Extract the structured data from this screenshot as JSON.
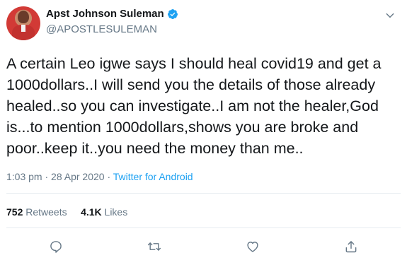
{
  "author": {
    "display_name": "Apst Johnson Suleman",
    "handle": "@APOSTLESULEMAN",
    "verified": true
  },
  "tweet": {
    "text": "A certain Leo igwe says I should heal covid19 and get a 1000dollars..I will send you the details of those already healed..so you can investigate..I am not the healer,God is...to mention 1000dollars,shows you are broke and poor..keep it..you need the money than me..",
    "time": "1:03 pm",
    "date": "28 Apr 2020",
    "separator": "·",
    "source": "Twitter for Android"
  },
  "stats": {
    "retweets_count": "752",
    "retweets_label": "Retweets",
    "likes_count": "4.1K",
    "likes_label": "Likes"
  },
  "icons": {
    "reply": "reply-icon",
    "retweet": "retweet-icon",
    "like": "like-icon",
    "share": "share-icon",
    "more": "chevron-down-icon",
    "verified": "verified-badge-icon"
  },
  "colors": {
    "accent": "#1da1f2",
    "secondary_text": "#657786",
    "primary_text": "#14171a",
    "divider": "#e6ecf0"
  }
}
